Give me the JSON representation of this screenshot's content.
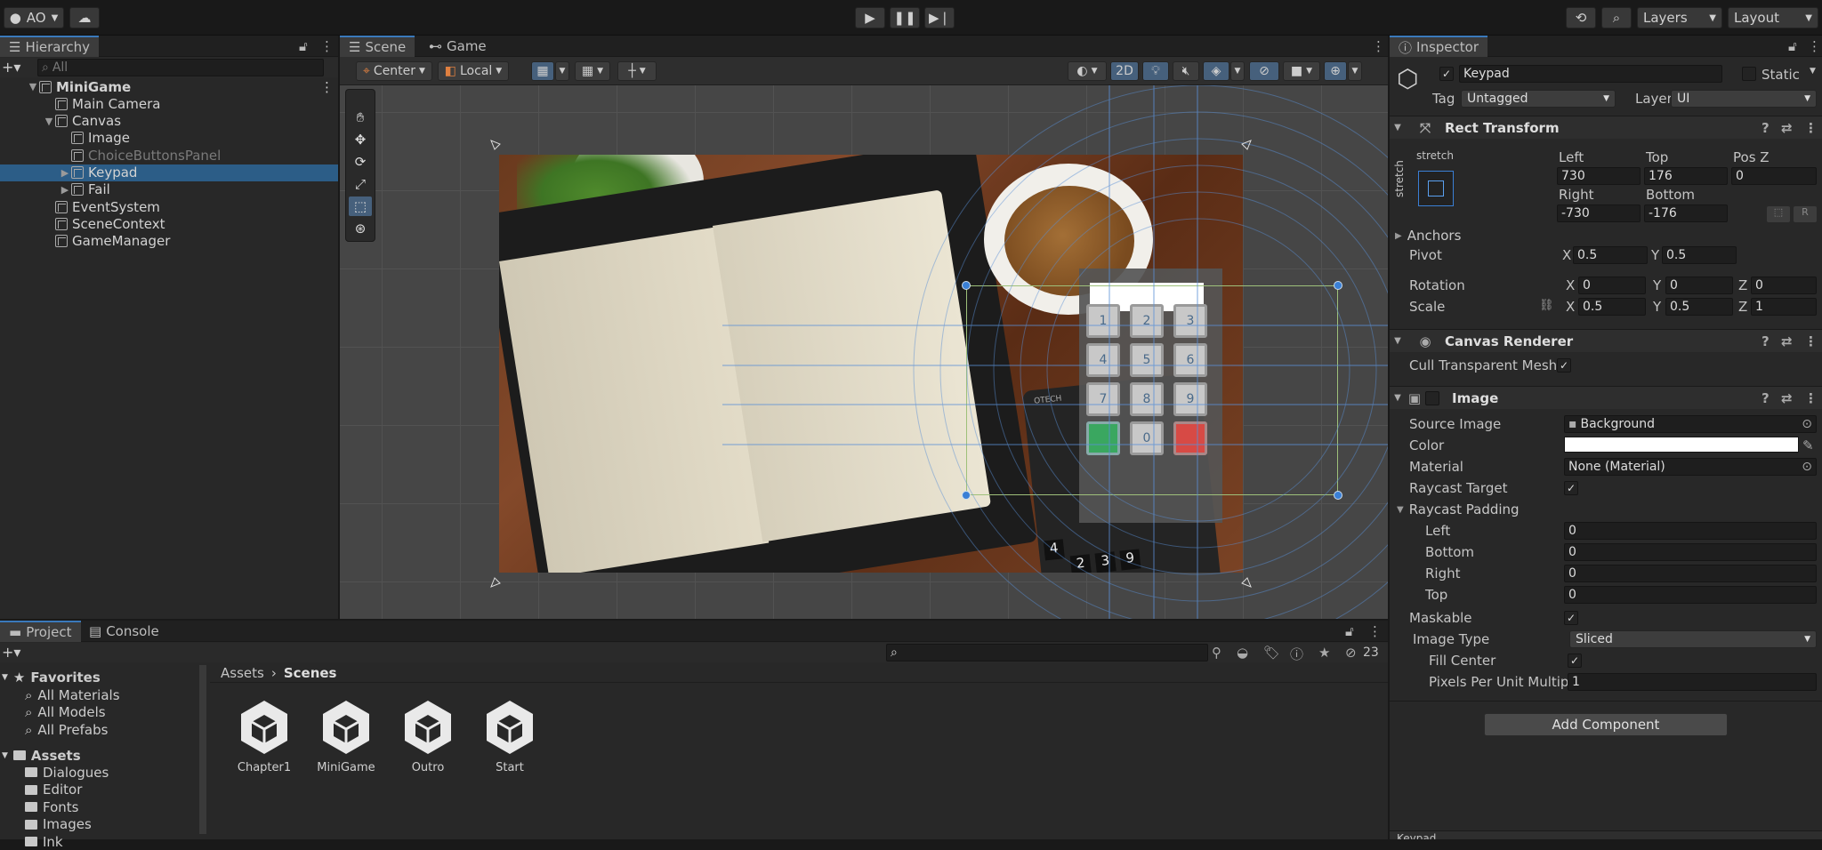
{
  "topbar": {
    "account": "AO",
    "layers_label": "Layers",
    "layout_label": "Layout"
  },
  "hierarchy": {
    "tab": "Hierarchy",
    "search_placeholder": "All",
    "items": [
      {
        "label": "MiniGame",
        "depth": 0,
        "expanded": true
      },
      {
        "label": "Main Camera",
        "depth": 1
      },
      {
        "label": "Canvas",
        "depth": 1,
        "expanded": true
      },
      {
        "label": "Image",
        "depth": 2
      },
      {
        "label": "ChoiceButtonsPanel",
        "depth": 2,
        "disabled": true
      },
      {
        "label": "Keypad",
        "depth": 2,
        "selected": true
      },
      {
        "label": "Fail",
        "depth": 2
      },
      {
        "label": "EventSystem",
        "depth": 1
      },
      {
        "label": "SceneContext",
        "depth": 1
      },
      {
        "label": "GameManager",
        "depth": 1
      }
    ]
  },
  "scene": {
    "tab_scene": "Scene",
    "tab_game": "Game",
    "pivot_mode": "Center",
    "space_mode": "Local",
    "mode_2d": "2D",
    "keypad_keys": [
      "1",
      "2",
      "3",
      "4",
      "5",
      "6",
      "7",
      "8",
      "9",
      "0"
    ],
    "calc_keys": [
      "4",
      "2",
      "3",
      "9"
    ],
    "calc_brand": "OTECH"
  },
  "inspector": {
    "tab": "Inspector",
    "object_name": "Keypad",
    "static_label": "Static",
    "tag_label": "Tag",
    "tag_value": "Untagged",
    "layer_label": "Layer",
    "layer_value": "UI",
    "rect": {
      "title": "Rect Transform",
      "stretch": "stretch",
      "left_label": "Left",
      "left": "730",
      "top_label": "Top",
      "top": "176",
      "posz_label": "Pos Z",
      "posz": "0",
      "right_label": "Right",
      "right": "-730",
      "bottom_label": "Bottom",
      "bottom": "-176",
      "anchors": "Anchors",
      "pivot_label": "Pivot",
      "pivot_x": "0.5",
      "pivot_y": "0.5",
      "rotation_label": "Rotation",
      "rot_x": "0",
      "rot_y": "0",
      "rot_z": "0",
      "scale_label": "Scale",
      "scale_x": "0.5",
      "scale_y": "0.5",
      "scale_z": "1"
    },
    "canvas_renderer": {
      "title": "Canvas Renderer",
      "cull_label": "Cull Transparent Mesh"
    },
    "image": {
      "title": "Image",
      "source_label": "Source Image",
      "source_value": "Background",
      "color_label": "Color",
      "material_label": "Material",
      "material_value": "None (Material)",
      "raycast_target": "Raycast Target",
      "raycast_padding": "Raycast Padding",
      "pad_left": "Left",
      "pad_left_val": "0",
      "pad_bottom": "Bottom",
      "pad_bottom_val": "0",
      "pad_right": "Right",
      "pad_right_val": "0",
      "pad_top": "Top",
      "pad_top_val": "0",
      "maskable": "Maskable",
      "image_type_label": "Image Type",
      "image_type": "Sliced",
      "fill_center": "Fill Center",
      "ppu_label": "Pixels Per Unit Multipl",
      "ppu_value": "1"
    },
    "add_component": "Add Component",
    "footer": "Keypad"
  },
  "project": {
    "tab_project": "Project",
    "tab_console": "Console",
    "hidden_count": "23",
    "favorites": "Favorites",
    "fav_items": [
      "All Materials",
      "All Models",
      "All Prefabs"
    ],
    "assets": "Assets",
    "asset_folders": [
      "Dialogues",
      "Editor",
      "Fonts",
      "Images",
      "Ink"
    ],
    "breadcrumb_root": "Assets",
    "breadcrumb_current": "Scenes",
    "scene_files": [
      "Chapter1",
      "MiniGame",
      "Outro",
      "Start"
    ]
  }
}
